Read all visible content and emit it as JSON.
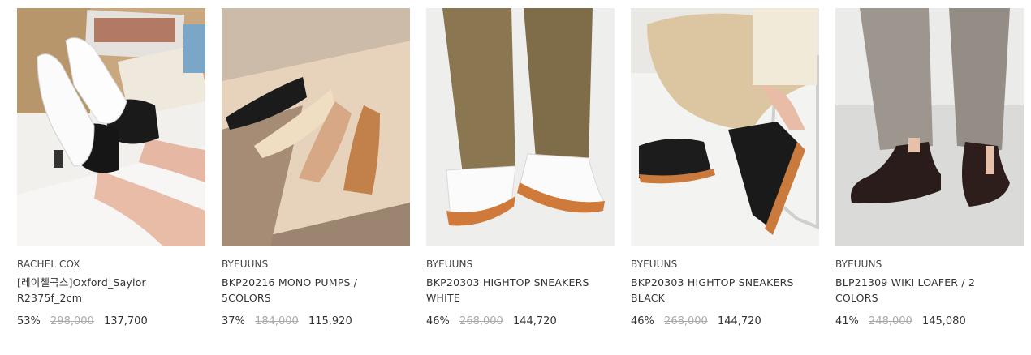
{
  "products": [
    {
      "brand": "RACHEL COX",
      "title_line1": "[레이첼콕스]Oxford_Saylor",
      "title_line2": "R2375f_2cm",
      "discount": "53%",
      "original_price": "298,000",
      "sale_price": "137,700",
      "image": "white-oxford-shoes-photo"
    },
    {
      "brand": "BYEUUNS",
      "title_line1": "BKP20216 MONO PUMPS /",
      "title_line2": "5COLORS",
      "discount": "37%",
      "original_price": "184,000",
      "sale_price": "115,920",
      "image": "mono-pumps-photo"
    },
    {
      "brand": "BYEUUNS",
      "title_line1": "BKP20303 HIGHTOP SNEAKERS",
      "title_line2": "WHITE",
      "discount": "46%",
      "original_price": "268,000",
      "sale_price": "144,720",
      "image": "white-hightop-sneakers-photo"
    },
    {
      "brand": "BYEUUNS",
      "title_line1": "BKP20303 HIGHTOP SNEAKERS",
      "title_line2": "BLACK",
      "discount": "46%",
      "original_price": "268,000",
      "sale_price": "144,720",
      "image": "black-hightop-sneakers-photo"
    },
    {
      "brand": "BYEUUNS",
      "title_line1": "BLP21309 WIKI LOAFER / 2",
      "title_line2": "COLORS",
      "discount": "41%",
      "original_price": "248,000",
      "sale_price": "145,080",
      "image": "wiki-loafer-photo"
    }
  ]
}
